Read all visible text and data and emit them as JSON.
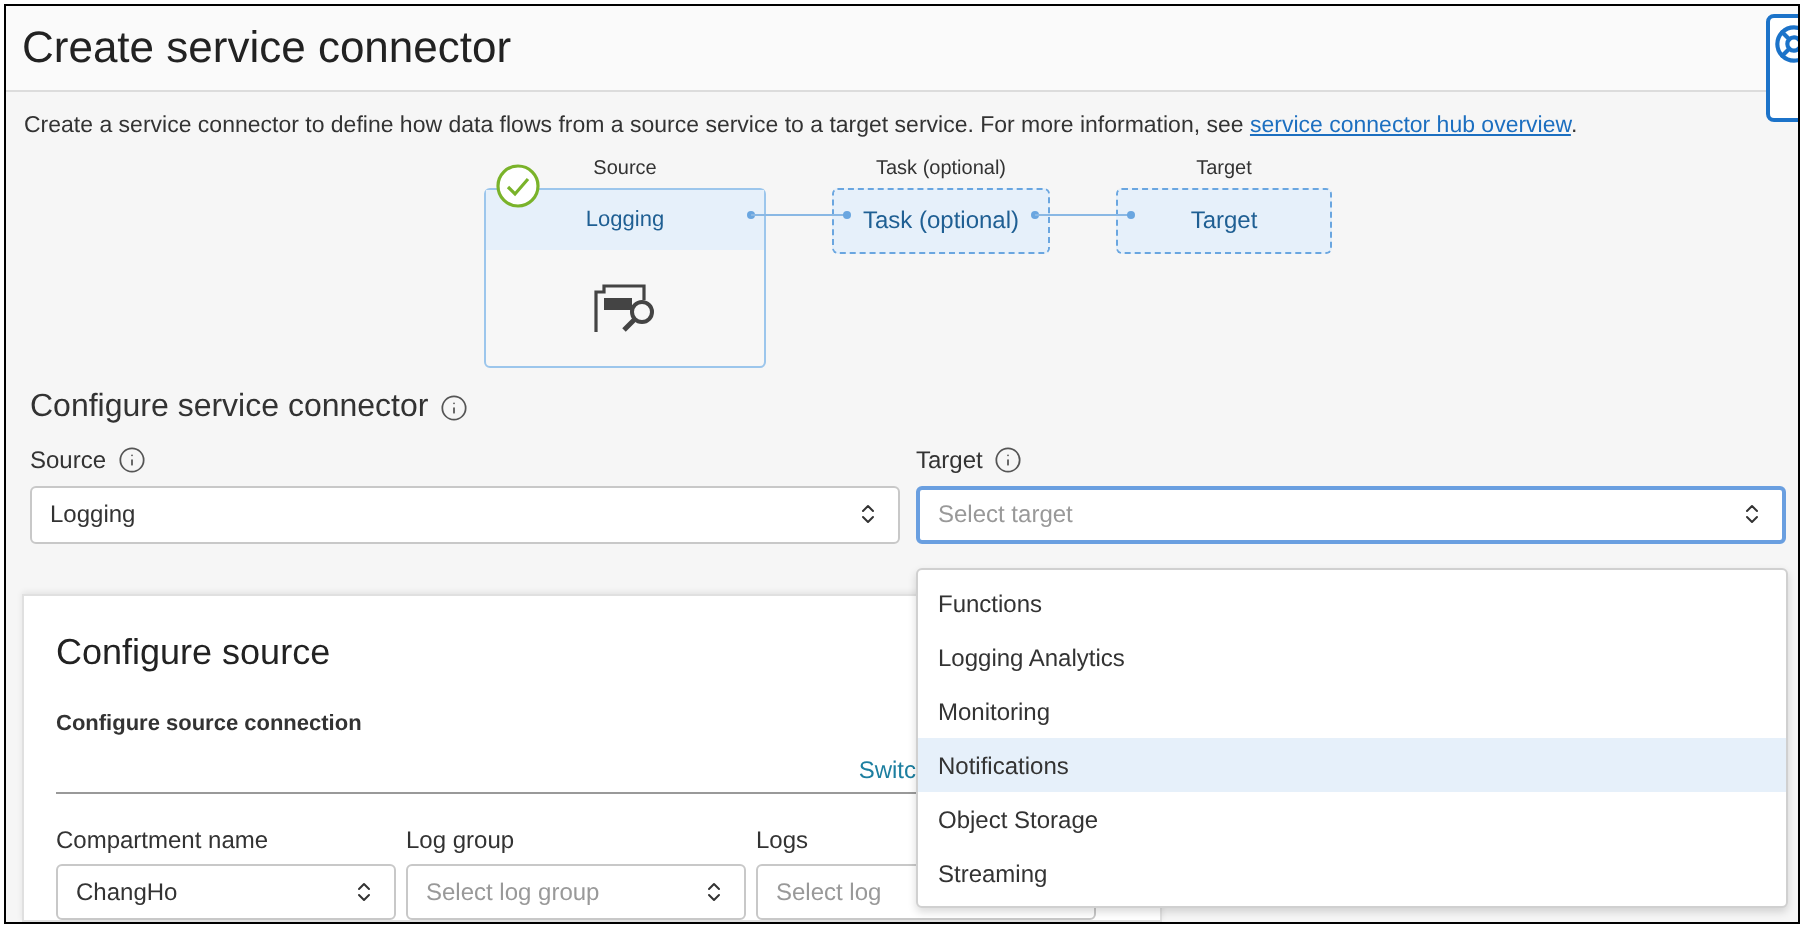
{
  "page": {
    "title": "Create service connector",
    "description": "Create a service connector to define how data flows from a source service to a target service. For more information, see ",
    "link": "service connector hub overview",
    "link_suffix": "."
  },
  "flow": [
    {
      "kind": "source",
      "caption": "Source",
      "label": "Logging",
      "done": true
    },
    {
      "kind": "task",
      "caption": "Task (optional)",
      "label": "Task (optional)"
    },
    {
      "kind": "target",
      "caption": "Target",
      "label": "Target"
    }
  ],
  "configure": {
    "heading": "Configure service connector",
    "source": {
      "label": "Source",
      "value": "Logging"
    },
    "target": {
      "label": "Target",
      "placeholder": "Select target",
      "expanded": true,
      "options": [
        {
          "label": "Functions",
          "selected": false
        },
        {
          "label": "Logging Analytics",
          "selected": false
        },
        {
          "label": "Monitoring",
          "selected": false
        },
        {
          "label": "Notifications",
          "selected": true
        },
        {
          "label": "Object Storage",
          "selected": false
        },
        {
          "label": "Streaming",
          "selected": false
        }
      ]
    }
  },
  "source_panel": {
    "heading": "Configure source",
    "subheading": "Configure source connection",
    "switch_link": "Switc",
    "fields": [
      {
        "label": "Compartment name",
        "value": "ChangHo"
      },
      {
        "label": "Log group",
        "placeholder": "Select log group"
      },
      {
        "label": "Logs",
        "placeholder": "Select log"
      }
    ]
  }
}
